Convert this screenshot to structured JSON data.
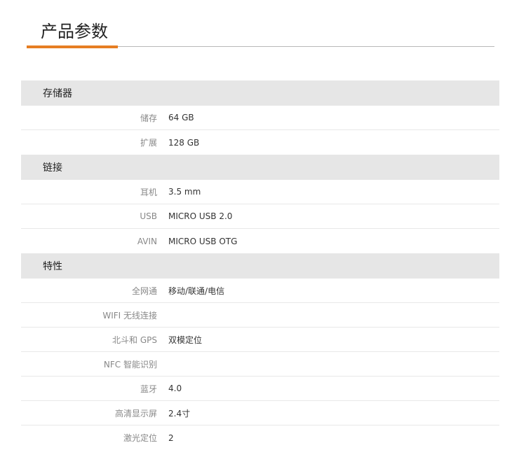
{
  "header": {
    "title": "产品参数"
  },
  "sections": [
    {
      "title": "存储器",
      "rows": [
        {
          "label": "储存",
          "value": "64 GB"
        },
        {
          "label": "扩展",
          "value": "128 GB"
        }
      ]
    },
    {
      "title": "链接",
      "rows": [
        {
          "label": "耳机",
          "value": "3.5 mm"
        },
        {
          "label": "USB",
          "value": "MICRO USB 2.0"
        },
        {
          "label": "AVIN",
          "value": "MICRO USB OTG"
        }
      ]
    },
    {
      "title": "特性",
      "rows": [
        {
          "label": "全网通",
          "value": "移动/联通/电信"
        },
        {
          "label": "WIFI 无线连接",
          "value": ""
        },
        {
          "label": "北斗和 GPS",
          "value": "双模定位"
        },
        {
          "label": "NFC 智能识别",
          "value": ""
        },
        {
          "label": "蓝牙",
          "value": "4.0"
        },
        {
          "label": "高清显示屏",
          "value": "2.4寸"
        },
        {
          "label": "激光定位",
          "value": "2"
        }
      ]
    }
  ],
  "colors": {
    "accent": "#e67e22",
    "section_bg": "#e6e6e6",
    "label_text": "#888888",
    "value_text": "#333333"
  }
}
